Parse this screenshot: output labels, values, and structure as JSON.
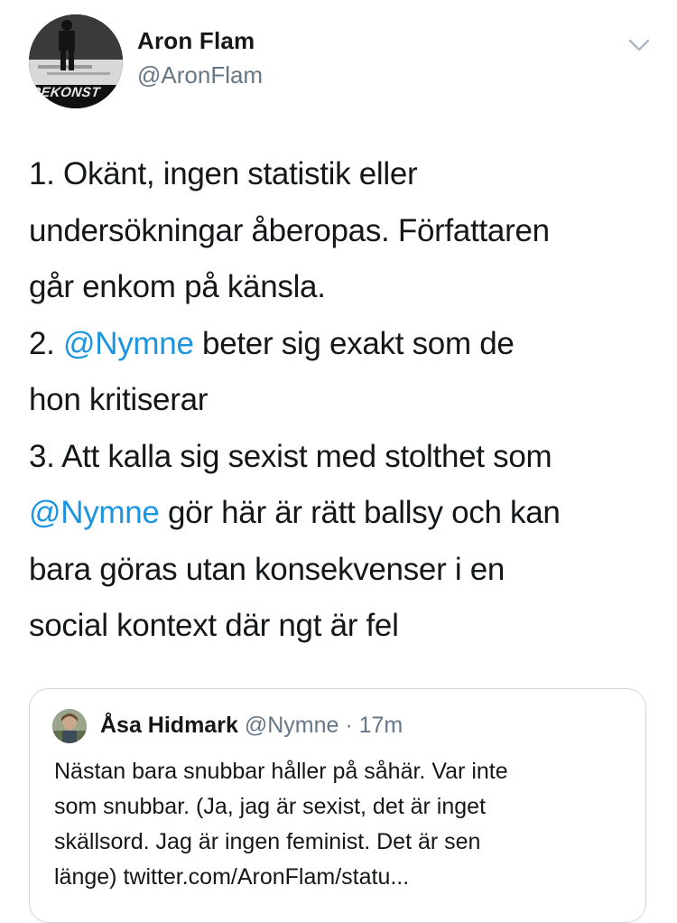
{
  "author": {
    "name": "Aron Flam",
    "handle": "@AronFlam",
    "avatar_text": "REKONST"
  },
  "tweet": {
    "lines": [
      [
        {
          "text": "1. Okänt, ingen statistik eller"
        }
      ],
      [
        {
          "text": "undersökningar åberopas. Författaren"
        }
      ],
      [
        {
          "text": "går enkom på känsla."
        }
      ],
      [
        {
          "text": "2. "
        },
        {
          "text": "@Nymne",
          "mention": true
        },
        {
          "text": " beter sig exakt som de"
        }
      ],
      [
        {
          "text": "hon kritiserar"
        }
      ],
      [
        {
          "text": "3. Att kalla sig sexist med stolthet som"
        }
      ],
      [
        {
          "text": "@Nymne",
          "mention": true
        },
        {
          "text": " gör här är rätt ballsy och kan"
        }
      ],
      [
        {
          "text": "bara göras utan konsekvenser i en"
        }
      ],
      [
        {
          "text": "social kontext där ngt är fel"
        }
      ]
    ]
  },
  "quoted_tweet": {
    "name": "Åsa Hidmark",
    "handle": "@Nymne",
    "separator": "·",
    "time": "17m",
    "lines": [
      "Nästan bara snubbar håller på såhär. Var inte",
      "som snubbar. (Ja, jag är sexist, det är inget",
      "skällsord. Jag är ingen feminist. Det är sen",
      "länge) twitter.com/AronFlam/statu..."
    ]
  },
  "icons": {
    "more": "chevron-down-icon"
  },
  "colors": {
    "text": "#14171a",
    "secondary": "#657786",
    "link": "#1b95e0",
    "border": "#ccd6dd"
  }
}
